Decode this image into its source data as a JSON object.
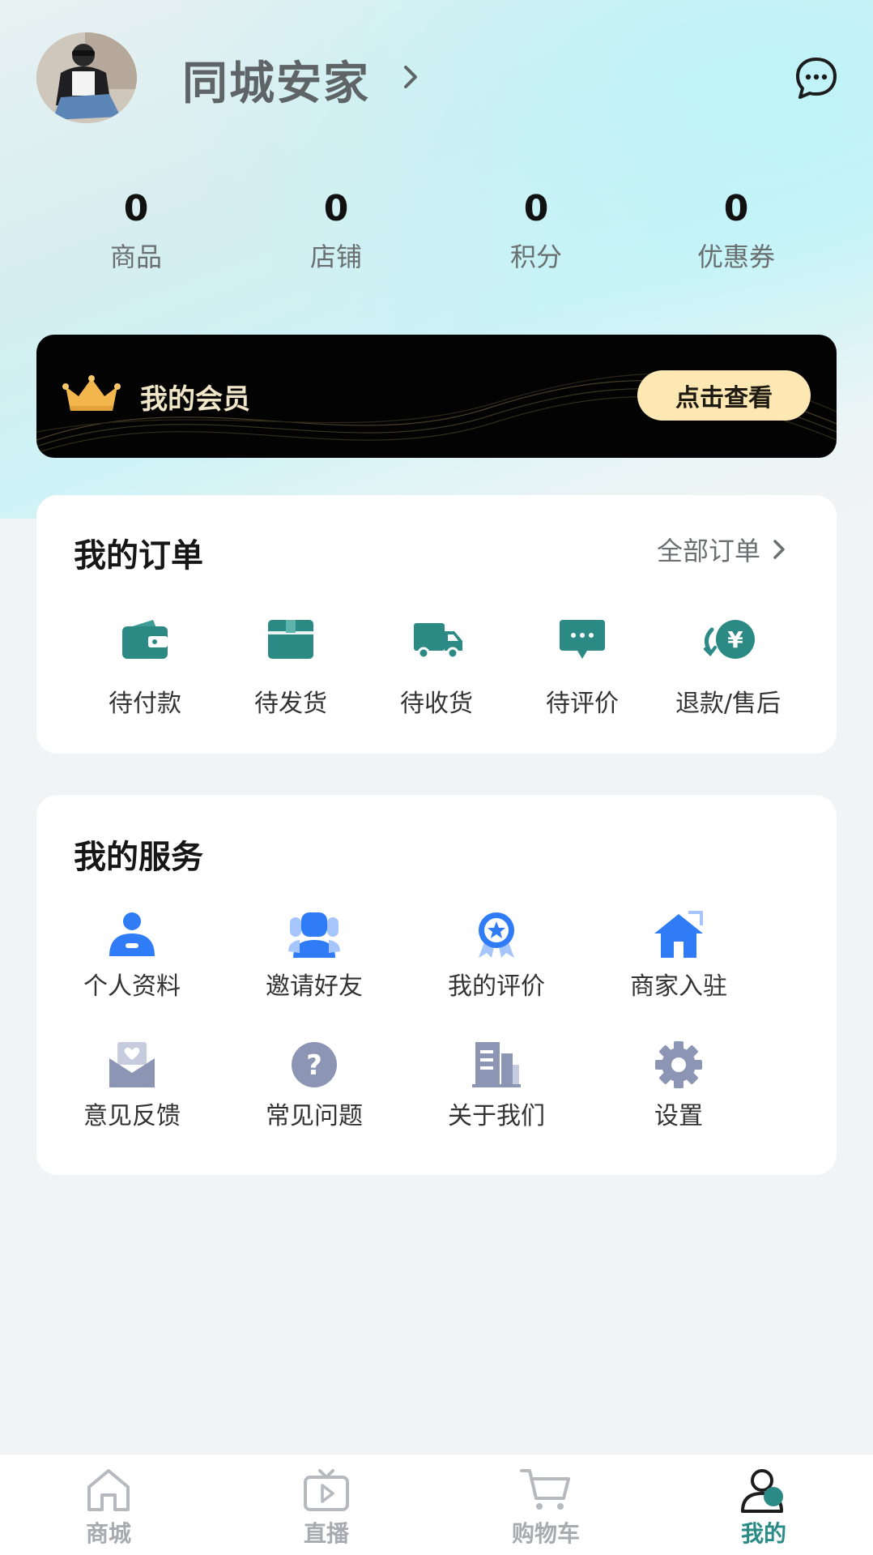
{
  "colors": {
    "accent": "#2a8a86",
    "service_blue": "#2f7cf6",
    "service_gray": "#8c95b4",
    "gold": "#fde7b3"
  },
  "profile": {
    "username": "同城安家",
    "avatar": "avatar"
  },
  "stats": [
    {
      "value": "0",
      "label": "商品"
    },
    {
      "value": "0",
      "label": "店铺"
    },
    {
      "value": "0",
      "label": "积分"
    },
    {
      "value": "0",
      "label": "优惠券"
    }
  ],
  "member": {
    "title": "我的会员",
    "button": "点击查看",
    "icon": "crown-icon"
  },
  "orders": {
    "title": "我的订单",
    "all_link": "全部订单",
    "items": [
      {
        "label": "待付款",
        "icon": "wallet-icon"
      },
      {
        "label": "待发货",
        "icon": "package-icon"
      },
      {
        "label": "待收货",
        "icon": "truck-icon"
      },
      {
        "label": "待评价",
        "icon": "comment-icon"
      },
      {
        "label": "退款/售后",
        "icon": "refund-yen-icon"
      }
    ]
  },
  "services": {
    "title": "我的服务",
    "items": [
      {
        "label": "个人资料",
        "icon": "person-icon"
      },
      {
        "label": "邀请好友",
        "icon": "invite-friends-icon"
      },
      {
        "label": "我的评价",
        "icon": "badge-star-icon"
      },
      {
        "label": "商家入驻",
        "icon": "store-house-icon"
      },
      {
        "label": "意见反馈",
        "icon": "feedback-envelope-icon"
      },
      {
        "label": "常见问题",
        "icon": "question-icon"
      },
      {
        "label": "关于我们",
        "icon": "building-icon"
      },
      {
        "label": "设置",
        "icon": "gear-icon"
      }
    ]
  },
  "tabbar": {
    "items": [
      {
        "label": "商城",
        "icon": "home-icon"
      },
      {
        "label": "直播",
        "icon": "tv-play-icon"
      },
      {
        "label": "购物车",
        "icon": "cart-icon"
      },
      {
        "label": "我的",
        "icon": "user-icon",
        "active": true
      }
    ]
  }
}
